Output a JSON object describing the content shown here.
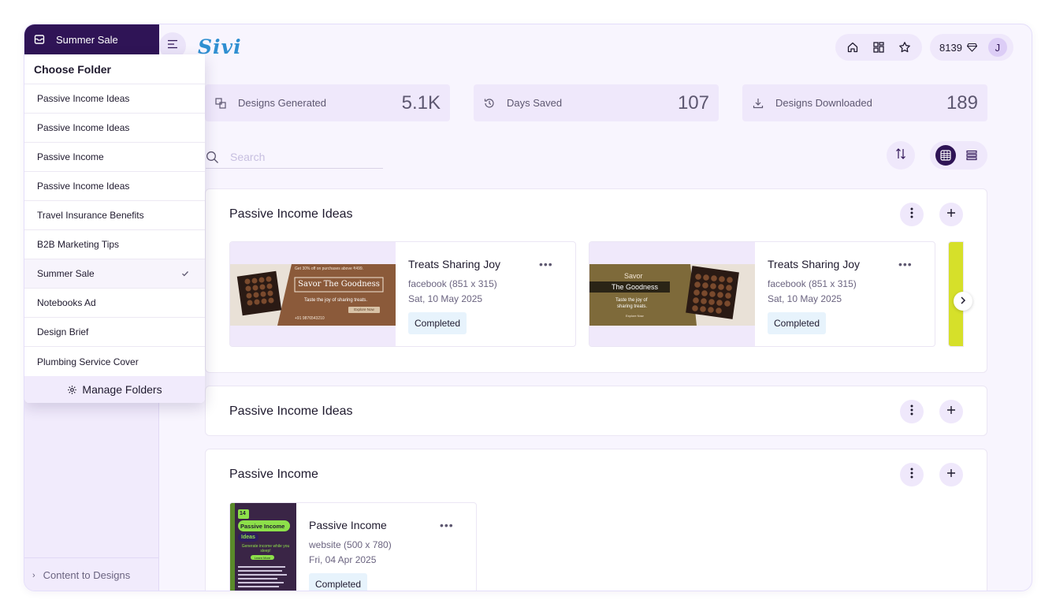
{
  "app": {
    "logo": "Sivi"
  },
  "sidebar": {
    "current_folder": "Summer Sale",
    "footer_label": "Content to Designs"
  },
  "dropdown": {
    "title": "Choose Folder",
    "items": [
      {
        "label": "Passive Income Ideas",
        "selected": false
      },
      {
        "label": "Passive Income Ideas",
        "selected": false
      },
      {
        "label": "Passive Income",
        "selected": false
      },
      {
        "label": "Passive Income Ideas",
        "selected": false
      },
      {
        "label": "Travel Insurance Benefits",
        "selected": false
      },
      {
        "label": "B2B Marketing Tips",
        "selected": false
      },
      {
        "label": "Summer Sale",
        "selected": true
      },
      {
        "label": "Notebooks Ad",
        "selected": false
      },
      {
        "label": "Design Brief",
        "selected": false
      },
      {
        "label": "Plumbing Service Cover",
        "selected": false
      }
    ],
    "manage_label": "Manage Folders"
  },
  "header": {
    "credits": "8139",
    "avatar_initial": "J",
    "nav_icons": [
      "home-icon",
      "grid-icon",
      "star-icon"
    ]
  },
  "stats": [
    {
      "label": "Designs Generated",
      "value": "5.1K",
      "icon": "designs-icon"
    },
    {
      "label": "Days Saved",
      "value": "107",
      "icon": "history-icon"
    },
    {
      "label": "Designs Downloaded",
      "value": "189",
      "icon": "download-icon"
    }
  ],
  "search": {
    "placeholder": "Search",
    "value": ""
  },
  "sections": [
    {
      "title": "Passive Income Ideas",
      "cards": [
        {
          "title": "Treats Sharing Joy",
          "subtitle": "facebook (851 x 315)",
          "date": "Sat, 10 May 2025",
          "status": "Completed",
          "thumb": {
            "promo": "Get 30% off on purchases above ₹499.",
            "headline": "Savor The Goodness",
            "tagline": "Taste the joy of sharing treats.",
            "cta": "Explore Now",
            "phone": "+91 9876543210"
          }
        },
        {
          "title": "Treats Sharing Joy",
          "subtitle": "facebook (851 x 315)",
          "date": "Sat, 10 May 2025",
          "status": "Completed",
          "thumb": {
            "line1": "Savor",
            "line2": "The Goodness",
            "tagline_a": "Taste the joy of",
            "tagline_b": "sharing treats.",
            "cta": "Explore Now"
          }
        }
      ]
    },
    {
      "title": "Passive Income Ideas",
      "cards": []
    },
    {
      "title": "Passive Income",
      "cards": [
        {
          "title": "Passive Income",
          "subtitle": "website (500 x 780)",
          "date": "Fri, 04 Apr 2025",
          "status": "Completed",
          "thumb": {
            "number": "14",
            "line1": "Passive Income",
            "line2": "Ideas",
            "tagline": "Generate income while you sleep!",
            "cta": "Learn More"
          }
        }
      ]
    }
  ],
  "colors": {
    "brand_dark": "#2f1456",
    "accent_light": "#efe8fb",
    "logo": "#2f8fd1",
    "badge_bg": "#e7f3fc"
  }
}
